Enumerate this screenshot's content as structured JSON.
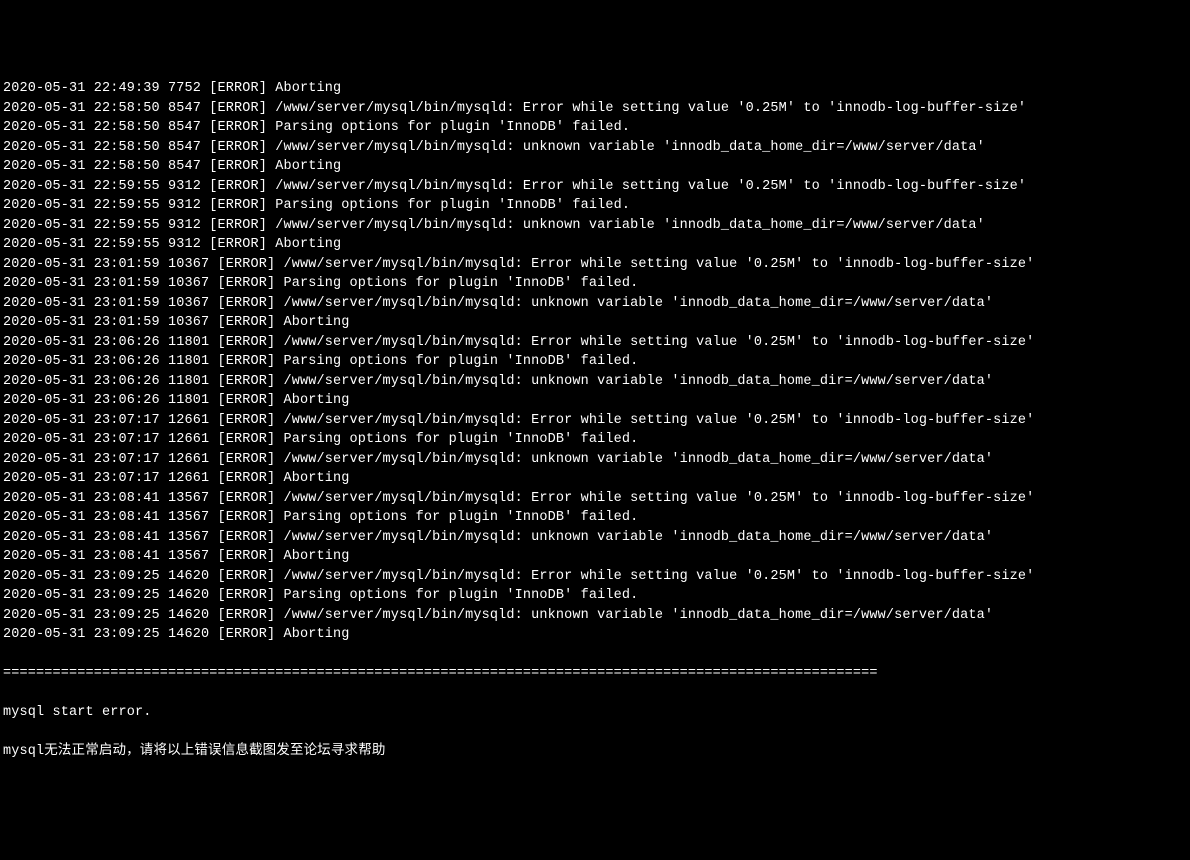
{
  "log_entries": [
    {
      "timestamp": "2020-05-31 22:49:39",
      "pid": "7752",
      "level": "[ERROR]",
      "message": "Aborting"
    },
    {
      "timestamp": "2020-05-31 22:58:50",
      "pid": "8547",
      "level": "[ERROR]",
      "message": "/www/server/mysql/bin/mysqld: Error while setting value '0.25M' to 'innodb-log-buffer-size'"
    },
    {
      "timestamp": "2020-05-31 22:58:50",
      "pid": "8547",
      "level": "[ERROR]",
      "message": "Parsing options for plugin 'InnoDB' failed."
    },
    {
      "timestamp": "2020-05-31 22:58:50",
      "pid": "8547",
      "level": "[ERROR]",
      "message": "/www/server/mysql/bin/mysqld: unknown variable 'innodb_data_home_dir=/www/server/data'"
    },
    {
      "timestamp": "2020-05-31 22:58:50",
      "pid": "8547",
      "level": "[ERROR]",
      "message": "Aborting"
    },
    {
      "timestamp": "2020-05-31 22:59:55",
      "pid": "9312",
      "level": "[ERROR]",
      "message": "/www/server/mysql/bin/mysqld: Error while setting value '0.25M' to 'innodb-log-buffer-size'"
    },
    {
      "timestamp": "2020-05-31 22:59:55",
      "pid": "9312",
      "level": "[ERROR]",
      "message": "Parsing options for plugin 'InnoDB' failed."
    },
    {
      "timestamp": "2020-05-31 22:59:55",
      "pid": "9312",
      "level": "[ERROR]",
      "message": "/www/server/mysql/bin/mysqld: unknown variable 'innodb_data_home_dir=/www/server/data'"
    },
    {
      "timestamp": "2020-05-31 22:59:55",
      "pid": "9312",
      "level": "[ERROR]",
      "message": "Aborting"
    },
    {
      "timestamp": "2020-05-31 23:01:59",
      "pid": "10367",
      "level": "[ERROR]",
      "message": "/www/server/mysql/bin/mysqld: Error while setting value '0.25M' to 'innodb-log-buffer-size'"
    },
    {
      "timestamp": "2020-05-31 23:01:59",
      "pid": "10367",
      "level": "[ERROR]",
      "message": "Parsing options for plugin 'InnoDB' failed."
    },
    {
      "timestamp": "2020-05-31 23:01:59",
      "pid": "10367",
      "level": "[ERROR]",
      "message": "/www/server/mysql/bin/mysqld: unknown variable 'innodb_data_home_dir=/www/server/data'"
    },
    {
      "timestamp": "2020-05-31 23:01:59",
      "pid": "10367",
      "level": "[ERROR]",
      "message": "Aborting"
    },
    {
      "timestamp": "2020-05-31 23:06:26",
      "pid": "11801",
      "level": "[ERROR]",
      "message": "/www/server/mysql/bin/mysqld: Error while setting value '0.25M' to 'innodb-log-buffer-size'"
    },
    {
      "timestamp": "2020-05-31 23:06:26",
      "pid": "11801",
      "level": "[ERROR]",
      "message": "Parsing options for plugin 'InnoDB' failed."
    },
    {
      "timestamp": "2020-05-31 23:06:26",
      "pid": "11801",
      "level": "[ERROR]",
      "message": "/www/server/mysql/bin/mysqld: unknown variable 'innodb_data_home_dir=/www/server/data'"
    },
    {
      "timestamp": "2020-05-31 23:06:26",
      "pid": "11801",
      "level": "[ERROR]",
      "message": "Aborting"
    },
    {
      "timestamp": "2020-05-31 23:07:17",
      "pid": "12661",
      "level": "[ERROR]",
      "message": "/www/server/mysql/bin/mysqld: Error while setting value '0.25M' to 'innodb-log-buffer-size'"
    },
    {
      "timestamp": "2020-05-31 23:07:17",
      "pid": "12661",
      "level": "[ERROR]",
      "message": "Parsing options for plugin 'InnoDB' failed."
    },
    {
      "timestamp": "2020-05-31 23:07:17",
      "pid": "12661",
      "level": "[ERROR]",
      "message": "/www/server/mysql/bin/mysqld: unknown variable 'innodb_data_home_dir=/www/server/data'"
    },
    {
      "timestamp": "2020-05-31 23:07:17",
      "pid": "12661",
      "level": "[ERROR]",
      "message": "Aborting"
    },
    {
      "timestamp": "2020-05-31 23:08:41",
      "pid": "13567",
      "level": "[ERROR]",
      "message": "/www/server/mysql/bin/mysqld: Error while setting value '0.25M' to 'innodb-log-buffer-size'"
    },
    {
      "timestamp": "2020-05-31 23:08:41",
      "pid": "13567",
      "level": "[ERROR]",
      "message": "Parsing options for plugin 'InnoDB' failed."
    },
    {
      "timestamp": "2020-05-31 23:08:41",
      "pid": "13567",
      "level": "[ERROR]",
      "message": "/www/server/mysql/bin/mysqld: unknown variable 'innodb_data_home_dir=/www/server/data'"
    },
    {
      "timestamp": "2020-05-31 23:08:41",
      "pid": "13567",
      "level": "[ERROR]",
      "message": "Aborting"
    },
    {
      "timestamp": "2020-05-31 23:09:25",
      "pid": "14620",
      "level": "[ERROR]",
      "message": "/www/server/mysql/bin/mysqld: Error while setting value '0.25M' to 'innodb-log-buffer-size'"
    },
    {
      "timestamp": "2020-05-31 23:09:25",
      "pid": "14620",
      "level": "[ERROR]",
      "message": "Parsing options for plugin 'InnoDB' failed."
    },
    {
      "timestamp": "2020-05-31 23:09:25",
      "pid": "14620",
      "level": "[ERROR]",
      "message": "/www/server/mysql/bin/mysqld: unknown variable 'innodb_data_home_dir=/www/server/data'"
    },
    {
      "timestamp": "2020-05-31 23:09:25",
      "pid": "14620",
      "level": "[ERROR]",
      "message": "Aborting"
    }
  ],
  "divider": "==========================================================================================================",
  "footer": {
    "line1": "mysql start error.",
    "line2": "mysql无法正常启动，请将以上错误信息截图发至论坛寻求帮助"
  }
}
